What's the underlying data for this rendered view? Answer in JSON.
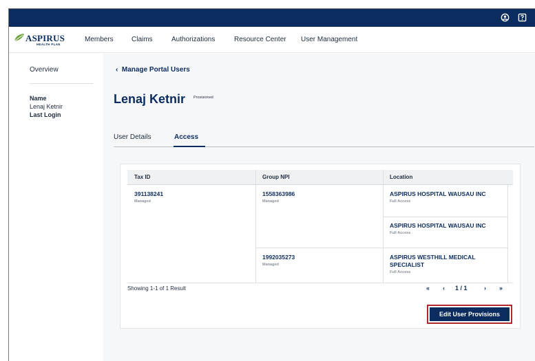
{
  "topbar": {
    "icons": [
      "user-circle-icon",
      "help-box-icon"
    ]
  },
  "brand": {
    "logo_text": "ASPIRUS",
    "logo_subtext": "HEALTH PLAN",
    "logo_color": "#0b2c5e",
    "leaf_color": "#6aa33a"
  },
  "nav": {
    "items": [
      {
        "label": "Members"
      },
      {
        "label": "Claims"
      },
      {
        "label": "Authorizations"
      },
      {
        "label": "Resource Center"
      },
      {
        "label": "User Management"
      }
    ]
  },
  "sidebar": {
    "overview": "Overview",
    "name_label": "Name",
    "name_value": "Lenaj Ketnir",
    "last_login_label": "Last Login"
  },
  "main": {
    "back_link": "Manage Portal Users",
    "back_chevron": "‹",
    "title": "Lenaj Ketnir",
    "status": "Provisioned",
    "tabs": [
      {
        "label": "User Details",
        "active": false
      },
      {
        "label": "Access",
        "active": true
      }
    ]
  },
  "table": {
    "headers": [
      "Tax ID",
      "Group NPI",
      "Location"
    ],
    "taxid": {
      "value": "391138241",
      "sub": "Managed"
    },
    "npi_rows": [
      {
        "value": "1558363986",
        "sub": "Managed"
      },
      {
        "value": "1992035273",
        "sub": "Managed"
      }
    ],
    "locations": [
      {
        "name": "ASPIRUS HOSPITAL WAUSAU INC",
        "sub": "Full Access"
      },
      {
        "name": "ASPIRUS HOSPITAL WAUSAU INC",
        "sub": "Full Access"
      },
      {
        "name": "ASPIRUS WESTHILL MEDICAL SPECIALIST",
        "sub": "Full Access"
      }
    ],
    "showing": "Showing 1-1 of 1 Result",
    "pager": {
      "first": "«",
      "prev": "‹",
      "page": "1 / 1",
      "next": "›",
      "last": "»"
    }
  },
  "actions": {
    "edit_button": "Edit User Provisions",
    "button_color": "#0b2c5e",
    "highlight_color": "#b2262c"
  }
}
